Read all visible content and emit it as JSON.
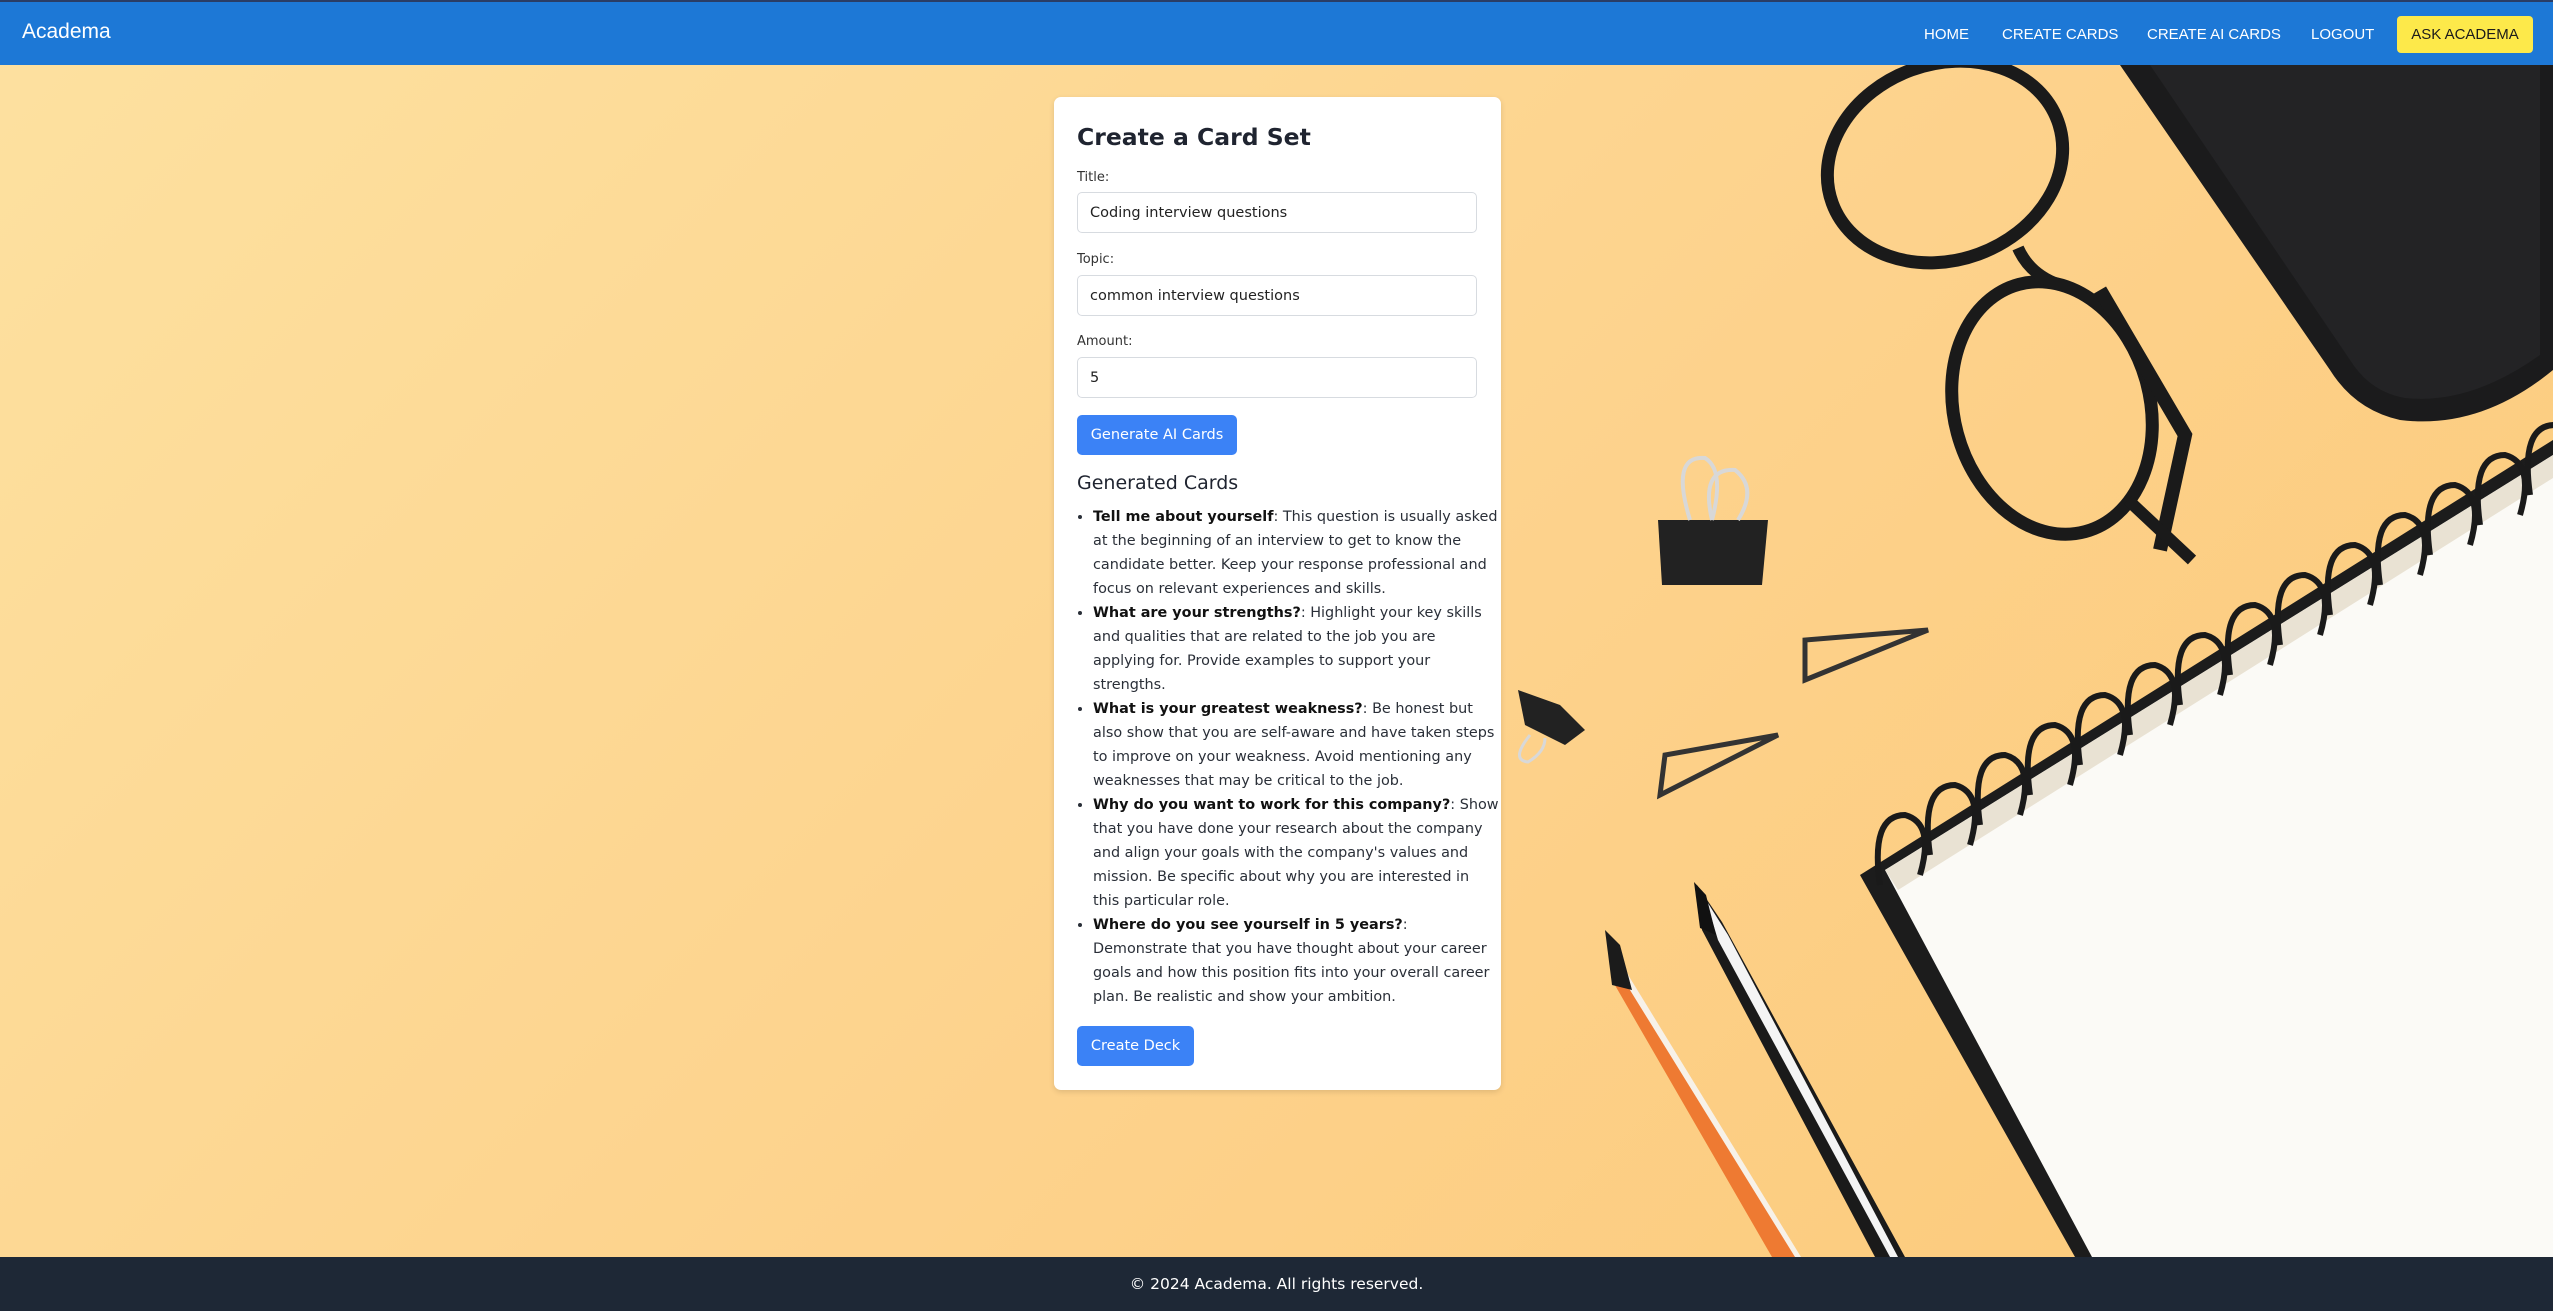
{
  "navbar": {
    "brand": "Academa",
    "links": [
      "HOME",
      "CREATE CARDS",
      "CREATE AI CARDS",
      "LOGOUT"
    ],
    "ask_button": "ASK ACADEMA"
  },
  "form": {
    "heading": "Create a Card Set",
    "title_label": "Title:",
    "title_value": "Coding interview questions",
    "topic_label": "Topic:",
    "topic_value": "common interview questions",
    "amount_label": "Amount:",
    "amount_value": "5",
    "generate_button": "Generate AI Cards"
  },
  "generated": {
    "heading": "Generated Cards",
    "cards": [
      {
        "question": "Tell me about yourself",
        "answer": ": This question is usually asked at the beginning of an interview to get to know the candidate better. Keep your response professional and focus on relevant experiences and skills."
      },
      {
        "question": "What are your strengths?",
        "answer": ": Highlight your key skills and qualities that are related to the job you are applying for. Provide examples to support your strengths."
      },
      {
        "question": "What is your greatest weakness?",
        "answer": ": Be honest but also show that you are self-aware and have taken steps to improve on your weakness. Avoid mentioning any weaknesses that may be critical to the job."
      },
      {
        "question": "Why do you want to work for this company?",
        "answer": ": Show that you have done your research about the company and align your goals with the company's values and mission. Be specific about why you are interested in this particular role."
      },
      {
        "question": "Where do you see yourself in 5 years?",
        "answer": ": Demonstrate that you have thought about your career goals and how this position fits into your overall career plan. Be realistic and show your ambition."
      }
    ],
    "create_button": "Create Deck"
  },
  "footer": {
    "text": "© 2024 Academa. All rights reserved."
  },
  "colors": {
    "navbar": "#1d78d6",
    "ask_button": "#fde94a",
    "primary_button": "#3b82f6",
    "footer": "#1e2836",
    "background": "#fdd28c"
  }
}
